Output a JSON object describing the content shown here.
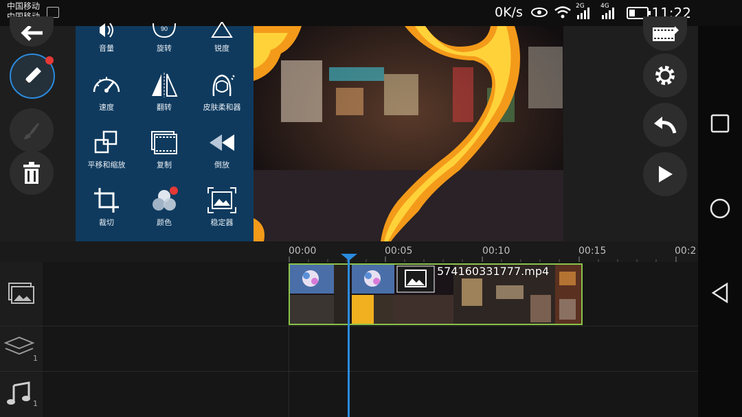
{
  "status_bar": {
    "carrier_1": "中国移动",
    "carrier_2": "中国移动",
    "net_speed": "0K/s",
    "signal_2g": "2G",
    "signal_4g": "4G",
    "time": "11:22"
  },
  "effects_panel": {
    "items": [
      {
        "label": "音量",
        "icon": "volume-icon"
      },
      {
        "label": "旋转",
        "icon": "rotate-icon",
        "badge": "90"
      },
      {
        "label": "锐度",
        "icon": "sharpness-icon"
      },
      {
        "label": "速度",
        "icon": "speed-icon"
      },
      {
        "label": "翻转",
        "icon": "flip-icon"
      },
      {
        "label": "皮肤柔和器",
        "icon": "skin-softener-icon"
      },
      {
        "label": "平移和缩放",
        "icon": "pan-zoom-icon"
      },
      {
        "label": "复制",
        "icon": "duplicate-icon"
      },
      {
        "label": "倒放",
        "icon": "reverse-icon"
      },
      {
        "label": "裁切",
        "icon": "crop-icon"
      },
      {
        "label": "颜色",
        "icon": "color-icon"
      },
      {
        "label": "稳定器",
        "icon": "stabilizer-icon"
      }
    ]
  },
  "timeline": {
    "ticks": [
      "00:00",
      "00:05",
      "00:10",
      "00:15",
      "00:2"
    ],
    "clip_name": "574160331777.mp4",
    "track_counts": {
      "layers": "1",
      "audio": "1"
    }
  },
  "colors": {
    "panel_blue": "#0f3a5e",
    "clip_border": "#8bc34a",
    "playhead": "#2a8bde",
    "badge_red": "#e53935"
  }
}
